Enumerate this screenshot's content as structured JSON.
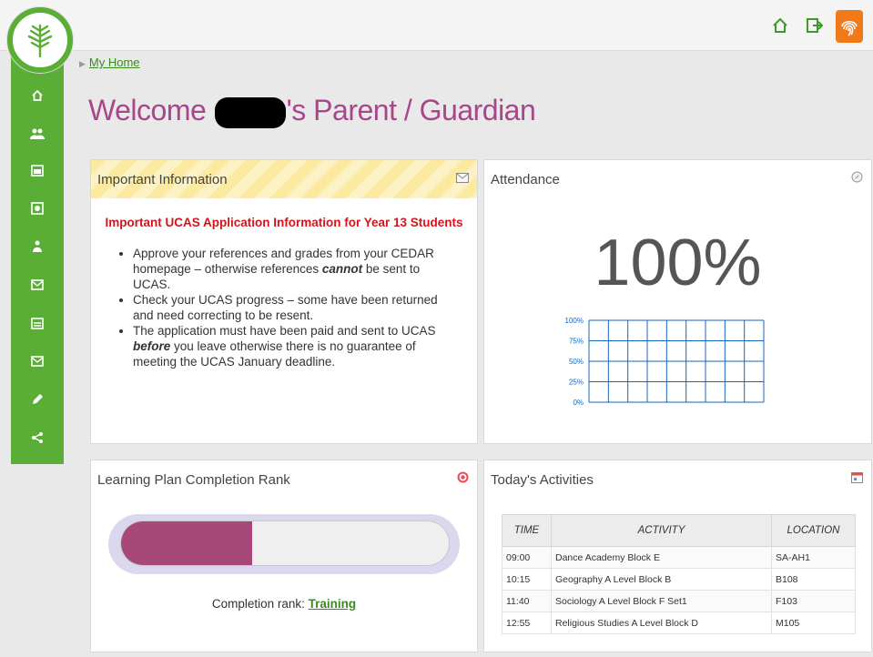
{
  "breadcrumb": {
    "label": "My Home"
  },
  "welcome": {
    "prefix": "Welcome ",
    "suffix": "'s Parent / Guardian"
  },
  "info_panel": {
    "title": "Important Information",
    "heading": "Important UCAS Application Information for Year 13 Students",
    "b1_pre": "Approve your references and grades from your CEDAR homepage – otherwise references ",
    "b1_em": "cannot",
    "b1_post": " be sent to UCAS.",
    "b2": "Check your UCAS progress – some have been returned and need correcting to be resent.",
    "b3_pre": "The application must have been paid and sent to UCAS ",
    "b3_em": "before",
    "b3_post": " you leave otherwise there is no guarantee of meeting the UCAS January deadline."
  },
  "attendance_panel": {
    "title": "Attendance",
    "value": "100%"
  },
  "chart_data": {
    "type": "bar",
    "categories": [
      "",
      "",
      "",
      "",
      "",
      "",
      "",
      "",
      ""
    ],
    "values": [],
    "ylim": [
      0,
      100
    ],
    "y_ticks": [
      "100%",
      "75%",
      "50%",
      "25%",
      "0%"
    ],
    "grid": true,
    "color": "#1565c0"
  },
  "learning_panel": {
    "title": "Learning Plan Completion Rank",
    "progress": 0.4,
    "rank_label": "Completion rank: ",
    "rank_value": "Training"
  },
  "activities_panel": {
    "title": "Today's Activities",
    "columns": [
      "TIME",
      "ACTIVITY",
      "LOCATION"
    ],
    "rows": [
      [
        "09:00",
        "Dance Academy Block E",
        "SA-AH1"
      ],
      [
        "10:15",
        "Geography A Level Block B",
        "B108"
      ],
      [
        "11:40",
        "Sociology A Level Block F Set1",
        "F103"
      ],
      [
        "12:55",
        "Religious Studies A Level Block D",
        "M105"
      ]
    ]
  },
  "colors": {
    "brand_green": "#5aae36",
    "welcome_purple": "#a8468c",
    "progress_fill": "#a84878",
    "alert_red": "#d4141a",
    "fingerprint_orange": "#f07a1a"
  },
  "icons": [
    "home-icon",
    "logout-icon",
    "fingerprint-icon",
    "tree-logo",
    "users-icon",
    "calendar-icon",
    "report-icon",
    "person-icon",
    "mail-icon",
    "target-icon",
    "compass-icon"
  ]
}
